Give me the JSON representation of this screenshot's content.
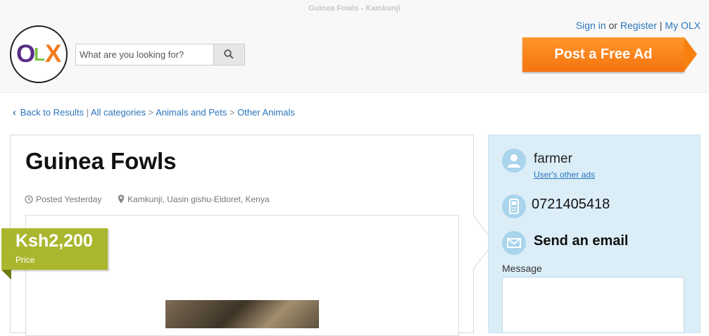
{
  "window": {
    "title": "Guinea Fowls - Kamkunji"
  },
  "header": {
    "logo_letters": [
      "O",
      "L",
      "X"
    ],
    "search": {
      "placeholder": "What are you looking for?",
      "value": ""
    },
    "search_icon": "search-icon",
    "links": {
      "sign_in": "Sign in",
      "or": "or",
      "register": "Register",
      "separator": "|",
      "my_olx": "My OLX"
    },
    "post_ad_label": "Post a Free Ad",
    "colors": {
      "post_ad": "#f5740f",
      "link": "#2a76bb"
    }
  },
  "breadcrumb": {
    "back_icon": "chevron-left-icon",
    "back": "Back to Results",
    "sep_pipe": "|",
    "items": [
      "All categories",
      "Animals and Pets",
      "Other Animals"
    ],
    "sep_arrow": ">"
  },
  "ad": {
    "title": "Guinea Fowls",
    "posted": "Posted Yesterday",
    "posted_icon": "clock-icon",
    "location": "Kamkunji, Uasin gishu-Eldoret, Kenya",
    "location_icon": "map-pin-icon",
    "price": "Ksh2,200",
    "price_label": "Price",
    "price_color": "#aab72e"
  },
  "seller": {
    "user_icon": "user-icon",
    "name": "farmer",
    "other_ads": "User's other ads",
    "phone_icon": "phone-icon",
    "phone": "0721405418",
    "email_icon": "envelope-icon",
    "send_email": "Send an email",
    "message_label": "Message",
    "message_value": ""
  }
}
